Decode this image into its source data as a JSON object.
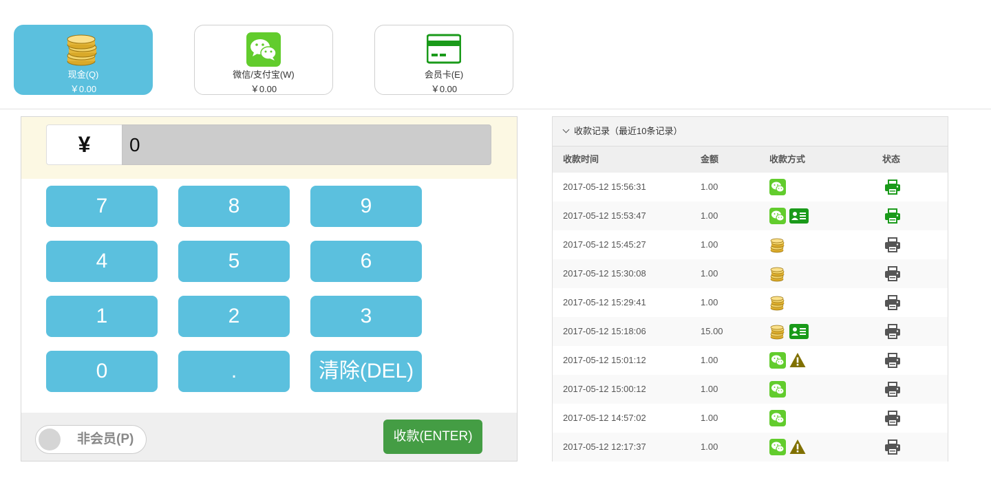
{
  "methods": [
    {
      "label": "现金(Q)",
      "amount": "￥0.00",
      "icon": "coins-icon"
    },
    {
      "label": "微信/支付宝(W)",
      "amount": "￥0.00",
      "icon": "wechat-icon"
    },
    {
      "label": "会员卡(E)",
      "amount": "￥0.00",
      "icon": "card-icon"
    }
  ],
  "active_method": "现金(Q)",
  "pad": {
    "currency": "¥",
    "amount": "0",
    "keys": [
      "7",
      "8",
      "9",
      "4",
      "5",
      "6",
      "1",
      "2",
      "3",
      "0",
      ".",
      "清除(DEL)"
    ],
    "member_toggle": "非会员(P)",
    "member_toggle_on": false,
    "submit": "收款(ENTER)"
  },
  "records": {
    "title": "收款记录（最近10条记录）",
    "columns": [
      "收款时间",
      "金额",
      "收款方式",
      "状态"
    ],
    "rows": [
      {
        "time": "2017-05-12 15:56:31",
        "amount": "1.00",
        "ways": [
          "wechat-icon"
        ],
        "status": "printed"
      },
      {
        "time": "2017-05-12 15:53:47",
        "amount": "1.00",
        "ways": [
          "wechat-icon",
          "member-card-icon"
        ],
        "status": "printed"
      },
      {
        "time": "2017-05-12 15:45:27",
        "amount": "1.00",
        "ways": [
          "coins-icon"
        ],
        "status": "not-printed"
      },
      {
        "time": "2017-05-12 15:30:08",
        "amount": "1.00",
        "ways": [
          "coins-icon"
        ],
        "status": "not-printed"
      },
      {
        "time": "2017-05-12 15:29:41",
        "amount": "1.00",
        "ways": [
          "coins-icon"
        ],
        "status": "not-printed"
      },
      {
        "time": "2017-05-12 15:18:06",
        "amount": "15.00",
        "ways": [
          "coins-icon",
          "member-card-icon"
        ],
        "status": "not-printed"
      },
      {
        "time": "2017-05-12 15:01:12",
        "amount": "1.00",
        "ways": [
          "wechat-icon",
          "warning-icon"
        ],
        "status": "not-printed"
      },
      {
        "time": "2017-05-12 15:00:12",
        "amount": "1.00",
        "ways": [
          "wechat-icon"
        ],
        "status": "not-printed"
      },
      {
        "time": "2017-05-12 14:57:02",
        "amount": "1.00",
        "ways": [
          "wechat-icon"
        ],
        "status": "not-printed"
      },
      {
        "time": "2017-05-12 12:17:37",
        "amount": "1.00",
        "ways": [
          "wechat-icon",
          "warning-icon"
        ],
        "status": "not-printed"
      }
    ]
  },
  "colors": {
    "accent": "#5bc0de",
    "submit": "#449d44",
    "wechat": "#62cc2d",
    "card_green": "#1a9a1a",
    "printer_ok": "#1a9a1a",
    "printer_idle": "#555555",
    "warning": "#807000"
  }
}
